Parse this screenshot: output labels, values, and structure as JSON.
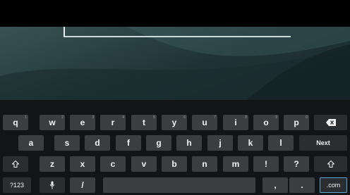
{
  "text_input": {
    "value": ""
  },
  "keyboard": {
    "row1": [
      {
        "label": "q",
        "hint": "1"
      },
      {
        "label": "w",
        "hint": "2"
      },
      {
        "label": "e",
        "hint": "3"
      },
      {
        "label": "r",
        "hint": "4"
      },
      {
        "label": "t",
        "hint": "5"
      },
      {
        "label": "y",
        "hint": "6"
      },
      {
        "label": "u",
        "hint": "7"
      },
      {
        "label": "i",
        "hint": "8"
      },
      {
        "label": "o",
        "hint": "9"
      },
      {
        "label": "p",
        "hint": "0"
      }
    ],
    "row2": [
      "a",
      "s",
      "d",
      "f",
      "g",
      "h",
      "j",
      "k",
      "l"
    ],
    "row3": [
      "z",
      "x",
      "c",
      "v",
      "b",
      "n",
      "m",
      "!",
      "?"
    ],
    "next_label": "Next",
    "symbols_label": "?123",
    "slash_label": "/",
    "comma_label": ",",
    "period_label": ".",
    "dotcom_label": ".com",
    "icons": {
      "backspace": "backspace-icon",
      "shift": "shift-icon",
      "mic": "microphone-icon"
    },
    "accent_color": "#5aa8d8"
  }
}
